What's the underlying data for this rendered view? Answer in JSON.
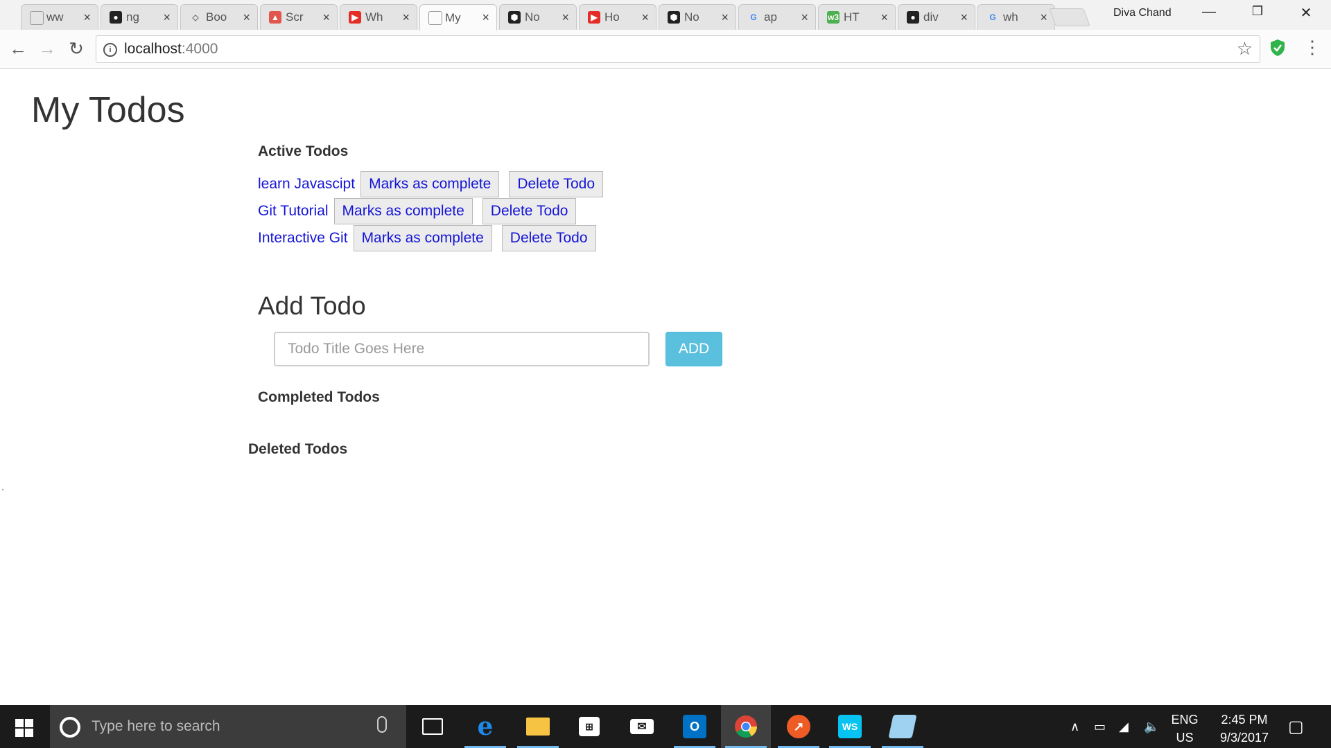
{
  "browser": {
    "tabs": [
      {
        "title": "ww",
        "icon": "page-icon",
        "color": "#ffffff"
      },
      {
        "title": "ng",
        "icon": "github-icon",
        "color": "#222222"
      },
      {
        "title": "Boo",
        "icon": "diamond-icon",
        "color": "#555555"
      },
      {
        "title": "Scr",
        "icon": "image-icon",
        "color": "#e0564d"
      },
      {
        "title": "Wh",
        "icon": "youtube-icon",
        "color": "#e52d27"
      },
      {
        "title": "My",
        "icon": "page-icon",
        "color": "#ffffff",
        "active": true
      },
      {
        "title": "No",
        "icon": "codepen-icon",
        "color": "#222222"
      },
      {
        "title": "Ho",
        "icon": "youtube-icon",
        "color": "#e52d27"
      },
      {
        "title": "No",
        "icon": "codepen-icon",
        "color": "#222222"
      },
      {
        "title": "ap",
        "icon": "google-icon",
        "color": "#4285f4"
      },
      {
        "title": "HT",
        "icon": "w3-icon",
        "color": "#4caf50"
      },
      {
        "title": "div",
        "icon": "github-icon",
        "color": "#222222"
      },
      {
        "title": "wh",
        "icon": "google-icon",
        "color": "#4285f4"
      }
    ],
    "profile_name": "Diva Chand",
    "url_host": "localhost",
    "url_port": ":4000"
  },
  "page": {
    "title": "My Todos",
    "active_heading": "Active Todos",
    "todos": [
      {
        "title": "learn Javascipt",
        "complete_label": "Marks as complete",
        "delete_label": "Delete Todo"
      },
      {
        "title": "Git Tutorial",
        "complete_label": "Marks as complete",
        "delete_label": "Delete Todo"
      },
      {
        "title": "Interactive Git",
        "complete_label": "Marks as complete",
        "delete_label": "Delete Todo"
      }
    ],
    "add_heading": "Add Todo",
    "input_placeholder": "Todo Title Goes Here",
    "input_value": "",
    "add_button": "ADD",
    "completed_heading": "Completed Todos",
    "deleted_heading": "Deleted Todos",
    "stray_text": "."
  },
  "taskbar": {
    "search_placeholder": "Type here to search",
    "apps": [
      {
        "name": "task-view-icon",
        "running": false
      },
      {
        "name": "edge-icon",
        "running": true
      },
      {
        "name": "file-explorer-icon",
        "running": true
      },
      {
        "name": "store-icon",
        "running": false
      },
      {
        "name": "mail-icon",
        "running": false
      },
      {
        "name": "outlook-icon",
        "running": true
      },
      {
        "name": "chrome-icon",
        "running": true,
        "active": true
      },
      {
        "name": "postman-icon",
        "running": true
      },
      {
        "name": "webstorm-icon",
        "running": true
      },
      {
        "name": "notepad-icon",
        "running": true
      }
    ],
    "lang_top": "ENG",
    "lang_bottom": "US",
    "time": "2:45 PM",
    "date": "9/3/2017"
  },
  "colors": {
    "link_blue": "#1515d6",
    "add_button": "#5bc0de",
    "taskbar": "#1b1b1b"
  }
}
